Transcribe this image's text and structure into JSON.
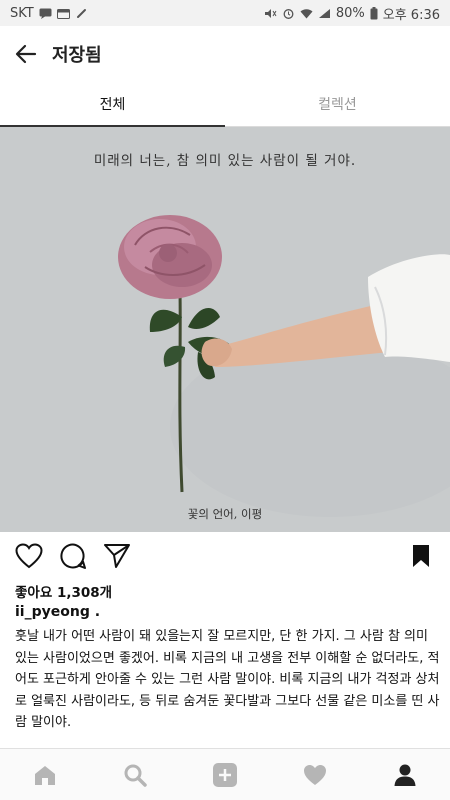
{
  "status_bar": {
    "carrier": "SKT",
    "battery": "80%",
    "time": "오후 6:36"
  },
  "header": {
    "title": "저장됨",
    "back_icon": "back-arrow-icon"
  },
  "tabs": [
    {
      "label": "전체",
      "active": true
    },
    {
      "label": "컬렉션",
      "active": false
    }
  ],
  "post": {
    "image_quote": "미래의 너는, 참 의미 있는 사람이 될 거야.",
    "image_credit": "꽃의 언어, 이평",
    "likes": "좋아요 1,308개",
    "username": "ii_pyeong .",
    "caption": "훗날 내가 어떤 사람이 돼 있을는지 잘 모르지만, 단 한 가지. 그 사람 참 의미 있는 사람이었으면 좋겠어. 비록 지금의 내 고생을 전부 이해할 순 없더라도, 적어도 포근하게 안아줄 수 있는 그런 사람 말이야. 비록 지금의 내가 걱정과 상처로 얼룩진 사람이라도, 등 뒤로 숨겨둔 꽃다발과 그보다 선물 같은 미소를 띤 사람 말이야."
  },
  "bottom_nav": [
    "home-icon",
    "search-icon",
    "add-icon",
    "heart-icon",
    "profile-icon"
  ]
}
